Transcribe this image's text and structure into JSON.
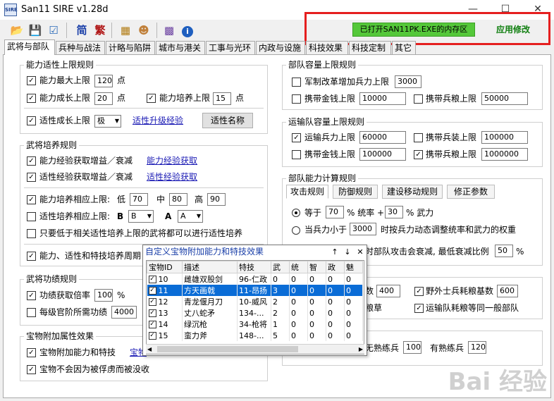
{
  "window": {
    "title": "San11 SIRE v1.28d",
    "app_icon": "SIRE",
    "minimize": "—",
    "maximize": "☐",
    "close": "✕"
  },
  "toolbar": {
    "simplified": "简",
    "traditional": "繁",
    "status": "已打开SAN11PK.EXE的内存区",
    "apply": "应用修改"
  },
  "tabs": [
    "武将与部队",
    "兵种与战法",
    "计略与陷阱",
    "城市与港关",
    "工事与光环",
    "内政与设施",
    "科技效果",
    "科技定制",
    "其它"
  ],
  "ability_limit": {
    "title": "能力适性上限规则",
    "max_label": "能力最大上限",
    "max_value": "120",
    "max_unit": "点",
    "growth_label": "能力成长上限",
    "growth_value": "20",
    "growth_unit": "点",
    "train_label": "能力培养上限",
    "train_value": "15",
    "train_unit": "点",
    "apt_label": "适性成长上限",
    "apt_value": "极",
    "apt_link": "适性升级经验",
    "apt_btn": "适性名称"
  },
  "general_train": {
    "title": "武将培养规则",
    "exp_gain": "能力经验获取增益／衰减",
    "exp_link": "能力经验获取",
    "apt_gain": "适性经验获取增益／衰减",
    "apt_link": "适性经验获取",
    "ability_cap": "能力培养相应上限:",
    "low": "低",
    "low_v": "70",
    "mid": "中",
    "mid_v": "80",
    "high": "高",
    "high_v": "90",
    "apt_cap": "适性培养相应上限:",
    "b_label": "B",
    "b_value": "B",
    "a_label": "A",
    "a_value": "A",
    "only_lower": "只要低于相关适性培养上限的武将都可以进行适性培养",
    "cycle": "能力、适性和特技培养周期"
  },
  "merit": {
    "title": "武将功绩规则",
    "rate_label": "功绩获取倍率",
    "rate_value": "100",
    "rate_unit": "%",
    "rank_label": "每级官阶所需功绩",
    "rank_value": "4000"
  },
  "treasure": {
    "title": "宝物附加属性效果",
    "add_label": "宝物附加能力和特技",
    "add_link": "宝物",
    "keep_label": "宝物不会因为被俘虏而被没收"
  },
  "unit_cap": {
    "title": "部队容量上限规则",
    "army_label": "军制改革增加兵力上限",
    "army_value": "3000",
    "gold_label": "携带金钱上限",
    "gold_value": "10000",
    "food_label": "携带兵粮上限",
    "food_value": "50000"
  },
  "transport_cap": {
    "title": "运输队容量上限规则",
    "troop_label": "运输兵力上限",
    "troop_value": "60000",
    "weapon_label": "携带兵装上限",
    "weapon_value": "100000",
    "gold_label": "携带金钱上限",
    "gold_value": "100000",
    "food_label": "携带兵粮上限",
    "food_value": "1000000"
  },
  "unit_calc": {
    "title": "部队能力计算规则",
    "subtabs": [
      "攻击规则",
      "防御规则",
      "建设移动规则",
      "修正参数"
    ],
    "eq_label": "等于",
    "eq_value": "70",
    "eq_mid": "% 统率 +",
    "eq_value2": "30",
    "eq_end": "% 武力",
    "below_label": "当兵力小于",
    "below_value": "3000",
    "below_end": "时按兵力动态调整统率和武力的权重",
    "decay_text": "时部队攻击会衰减, 最低衰减比例",
    "decay_value": "50",
    "decay_unit": "%"
  },
  "supply": {
    "num_suffix": "数",
    "num_value": "400",
    "field_label": "野外士兵耗粮基数",
    "field_value": "600",
    "grass_suffix": "粮草",
    "transport_label": "运输队耗粮等同一般部队"
  },
  "training": {
    "unskilled": "无熟练兵",
    "unskilled_value": "100",
    "skilled": "有熟练兵",
    "skilled_value": "120"
  },
  "popup": {
    "title": "自定义宝物附加能力和特技效果",
    "up": "↑",
    "down": "↓",
    "close": "✕",
    "columns": [
      "宝物ID",
      "描述",
      "特技",
      "武",
      "统",
      "智",
      "政",
      "魅"
    ],
    "rows": [
      {
        "id": "10",
        "desc": "雌雄双股剑",
        "skill": "96-仁政",
        "a": "0",
        "b": "0",
        "c": "0",
        "d": "0",
        "e": "0",
        "checked": true,
        "selected": false
      },
      {
        "id": "11",
        "desc": "方天画戟",
        "skill": "11-昂扬",
        "a": "3",
        "b": "0",
        "c": "0",
        "d": "0",
        "e": "0",
        "checked": true,
        "selected": true
      },
      {
        "id": "12",
        "desc": "青龙偃月刀",
        "skill": "10-威风",
        "a": "2",
        "b": "0",
        "c": "0",
        "d": "0",
        "e": "0",
        "checked": true,
        "selected": false
      },
      {
        "id": "13",
        "desc": "丈八蛇矛",
        "skill": "134-...",
        "a": "2",
        "b": "0",
        "c": "0",
        "d": "0",
        "e": "0",
        "checked": true,
        "selected": false
      },
      {
        "id": "14",
        "desc": "绿沉枪",
        "skill": "34-枪将",
        "a": "1",
        "b": "0",
        "c": "0",
        "d": "0",
        "e": "0",
        "checked": true,
        "selected": false
      },
      {
        "id": "15",
        "desc": "蛮力斧",
        "skill": "148-...",
        "a": "5",
        "b": "0",
        "c": "0",
        "d": "0",
        "e": "0",
        "checked": true,
        "selected": false
      }
    ]
  },
  "watermark": "Bai 经验"
}
